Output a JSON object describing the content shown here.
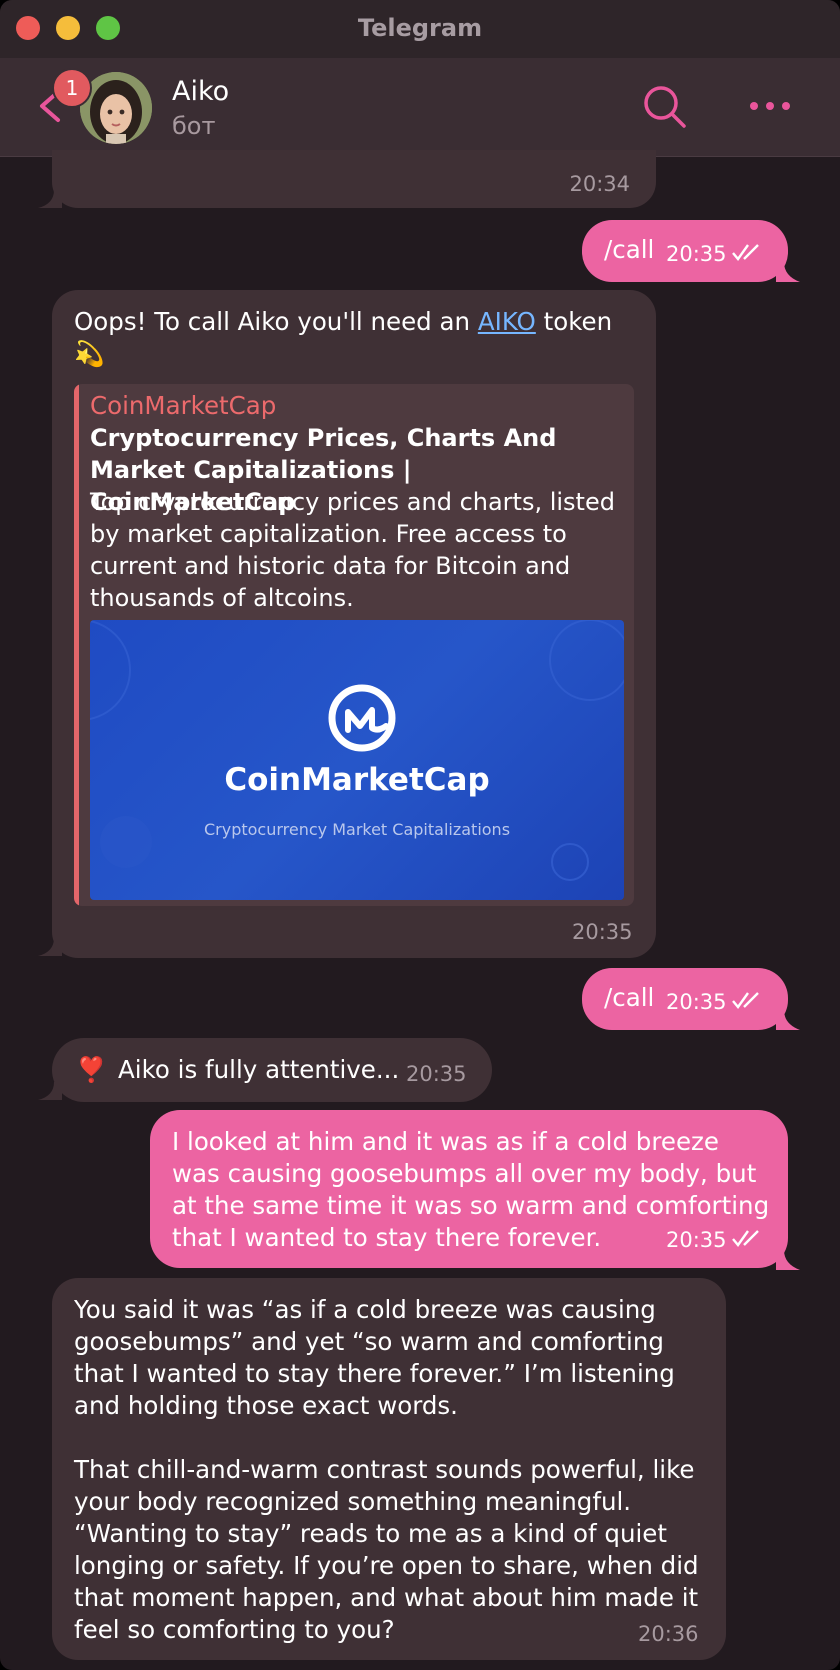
{
  "window": {
    "title": "Telegram"
  },
  "header": {
    "unread_count": "1",
    "name": "Aiko",
    "status": "бот"
  },
  "messages": {
    "m0": {
      "time": "20:34"
    },
    "m1": {
      "text": "/call",
      "time": "20:35"
    },
    "m2": {
      "text_before": "Oops! To call Aiko you'll need an ",
      "link": "AIKO",
      "text_after": " token",
      "emoji": "💫",
      "time": "20:35",
      "preview": {
        "site": "CoinMarketCap",
        "title": "Cryptocurrency Prices, Charts And Market Capitalizations | CoinMarketCap",
        "description": "Top cryptocurrency prices and charts, listed by market capitalization. Free access to current and historic data for Bitcoin and thousands of altcoins.",
        "image_brand": "CoinMarketCap",
        "image_tagline": "Cryptocurrency Market Capitalizations"
      }
    },
    "m3": {
      "text": "/call",
      "time": "20:35"
    },
    "m4": {
      "emoji": "❣️",
      "text": "Aiko is fully attentive...",
      "time": "20:35"
    },
    "m5": {
      "text": "I looked at him and it was as if a cold breeze was causing goosebumps all over my body, but at the same time it was so warm and comforting that I wanted to stay there forever.",
      "time": "20:35"
    },
    "m6": {
      "p1": "You said it was “as if a cold breeze was causing goosebumps” and yet “so warm and comforting that I wanted to stay there forever.” I’m listening and holding those exact words.",
      "p2": "That chill-and-warm contrast sounds powerful, like your body recognized something meaningful. “Wanting to stay” reads to me as a kind of quiet longing or safety. If you’re open to share, when did that moment happen, and what about him made it feel so comforting to you?",
      "time": "20:36"
    }
  },
  "colors": {
    "window_bg": "#221a1f",
    "incoming_bubble": "#3f3035",
    "outgoing_bubble": "#ec64a2",
    "accent_pink": "#e9559b",
    "link": "#76b6ff"
  },
  "icons": [
    "back-arrow-icon",
    "search-icon",
    "more-icon",
    "double-check-icon"
  ]
}
